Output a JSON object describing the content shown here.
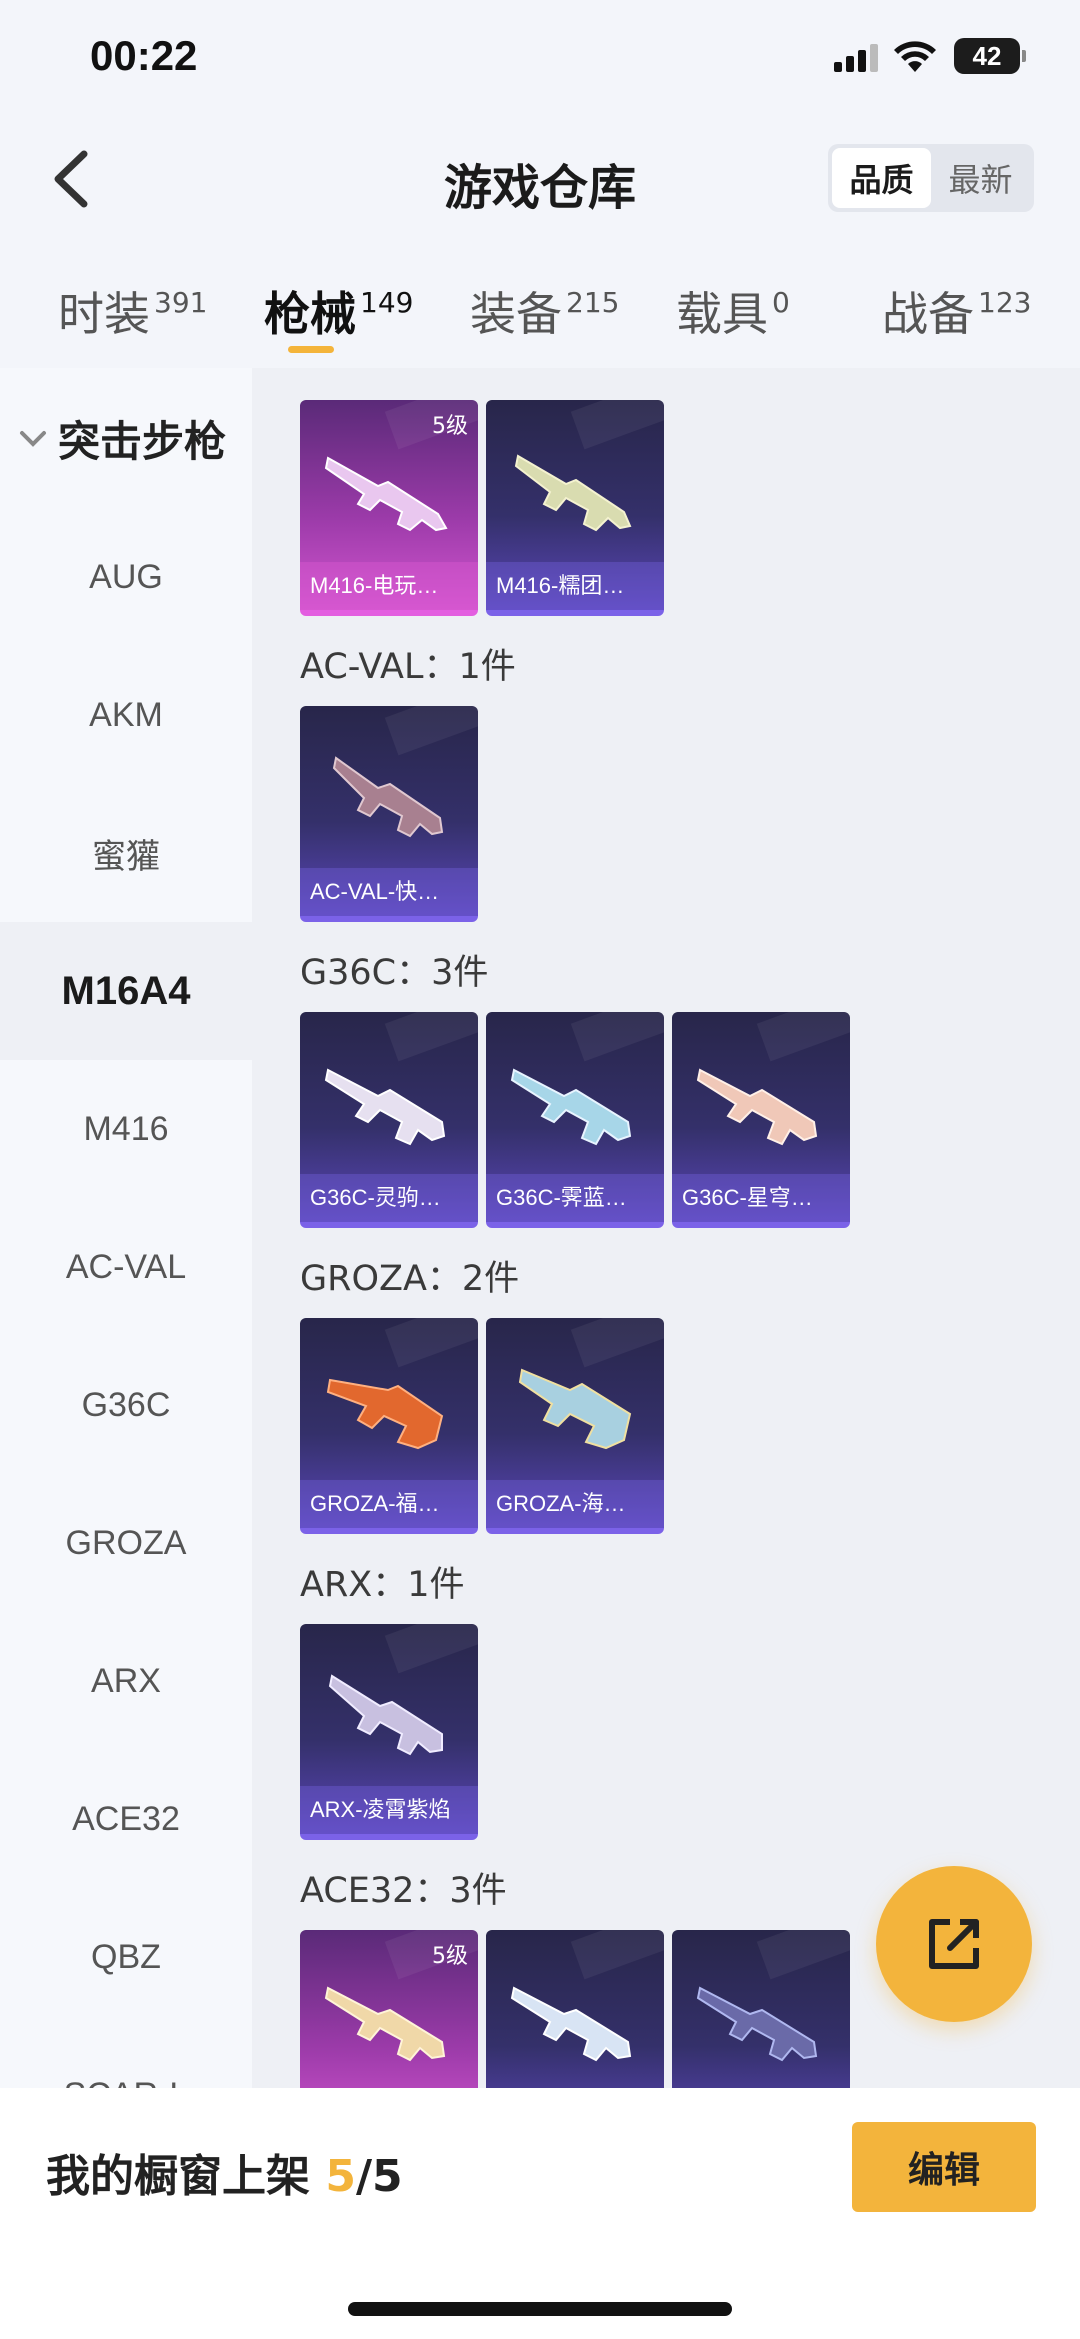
{
  "status": {
    "time": "00:22",
    "battery": "42"
  },
  "header": {
    "title": "游戏仓库",
    "sort_options": [
      "品质",
      "最新"
    ]
  },
  "tabs": [
    {
      "label": "时装",
      "count": "391"
    },
    {
      "label": "枪械",
      "count": "149"
    },
    {
      "label": "装备",
      "count": "215"
    },
    {
      "label": "载具",
      "count": "0"
    },
    {
      "label": "战备",
      "count": "123"
    }
  ],
  "sidebar": {
    "category": "突击步枪",
    "items": [
      "AUG",
      "AKM",
      "蜜獾",
      "M16A4",
      "M416",
      "AC-VAL",
      "G36C",
      "GROZA",
      "ARX",
      "ACE32",
      "QBZ",
      "SCAR-L"
    ]
  },
  "groups": [
    {
      "title": "",
      "cards": [
        {
          "label": "M416-电玩…",
          "level": "5级",
          "rarity": "legendary"
        },
        {
          "label": "M416-糯团…",
          "level": "",
          "rarity": "epic"
        }
      ]
    },
    {
      "title": "AC-VAL：1件",
      "cards": [
        {
          "label": "AC-VAL-快…",
          "level": "",
          "rarity": "epic"
        }
      ]
    },
    {
      "title": "G36C：3件",
      "cards": [
        {
          "label": "G36C-灵驹…",
          "level": "",
          "rarity": "epic"
        },
        {
          "label": "G36C-霁蓝…",
          "level": "",
          "rarity": "epic"
        },
        {
          "label": "G36C-星穹…",
          "level": "",
          "rarity": "epic"
        }
      ]
    },
    {
      "title": "GROZA：2件",
      "cards": [
        {
          "label": "GROZA-福…",
          "level": "",
          "rarity": "epic"
        },
        {
          "label": "GROZA-海…",
          "level": "",
          "rarity": "epic"
        }
      ]
    },
    {
      "title": "ARX：1件",
      "cards": [
        {
          "label": "ARX-凌霄紫焰",
          "level": "",
          "rarity": "epic"
        }
      ]
    },
    {
      "title": "ACE32：3件",
      "cards": [
        {
          "label": "",
          "level": "5级",
          "rarity": "legendary"
        },
        {
          "label": "",
          "level": "",
          "rarity": "epic"
        },
        {
          "label": "",
          "level": "",
          "rarity": "epic"
        }
      ]
    }
  ],
  "bottom": {
    "showcase_label": "我的橱窗上架 ",
    "showcase_count": "5",
    "showcase_total": "/5",
    "edit_label": "编辑"
  },
  "colors": {
    "accent": "#f3b43c",
    "epic": "#6a52d8",
    "legendary": "#d255cf"
  },
  "icons": {
    "back": "back-chevron-icon",
    "share": "share-external-icon",
    "signal": "signal-icon",
    "wifi": "wifi-icon"
  }
}
